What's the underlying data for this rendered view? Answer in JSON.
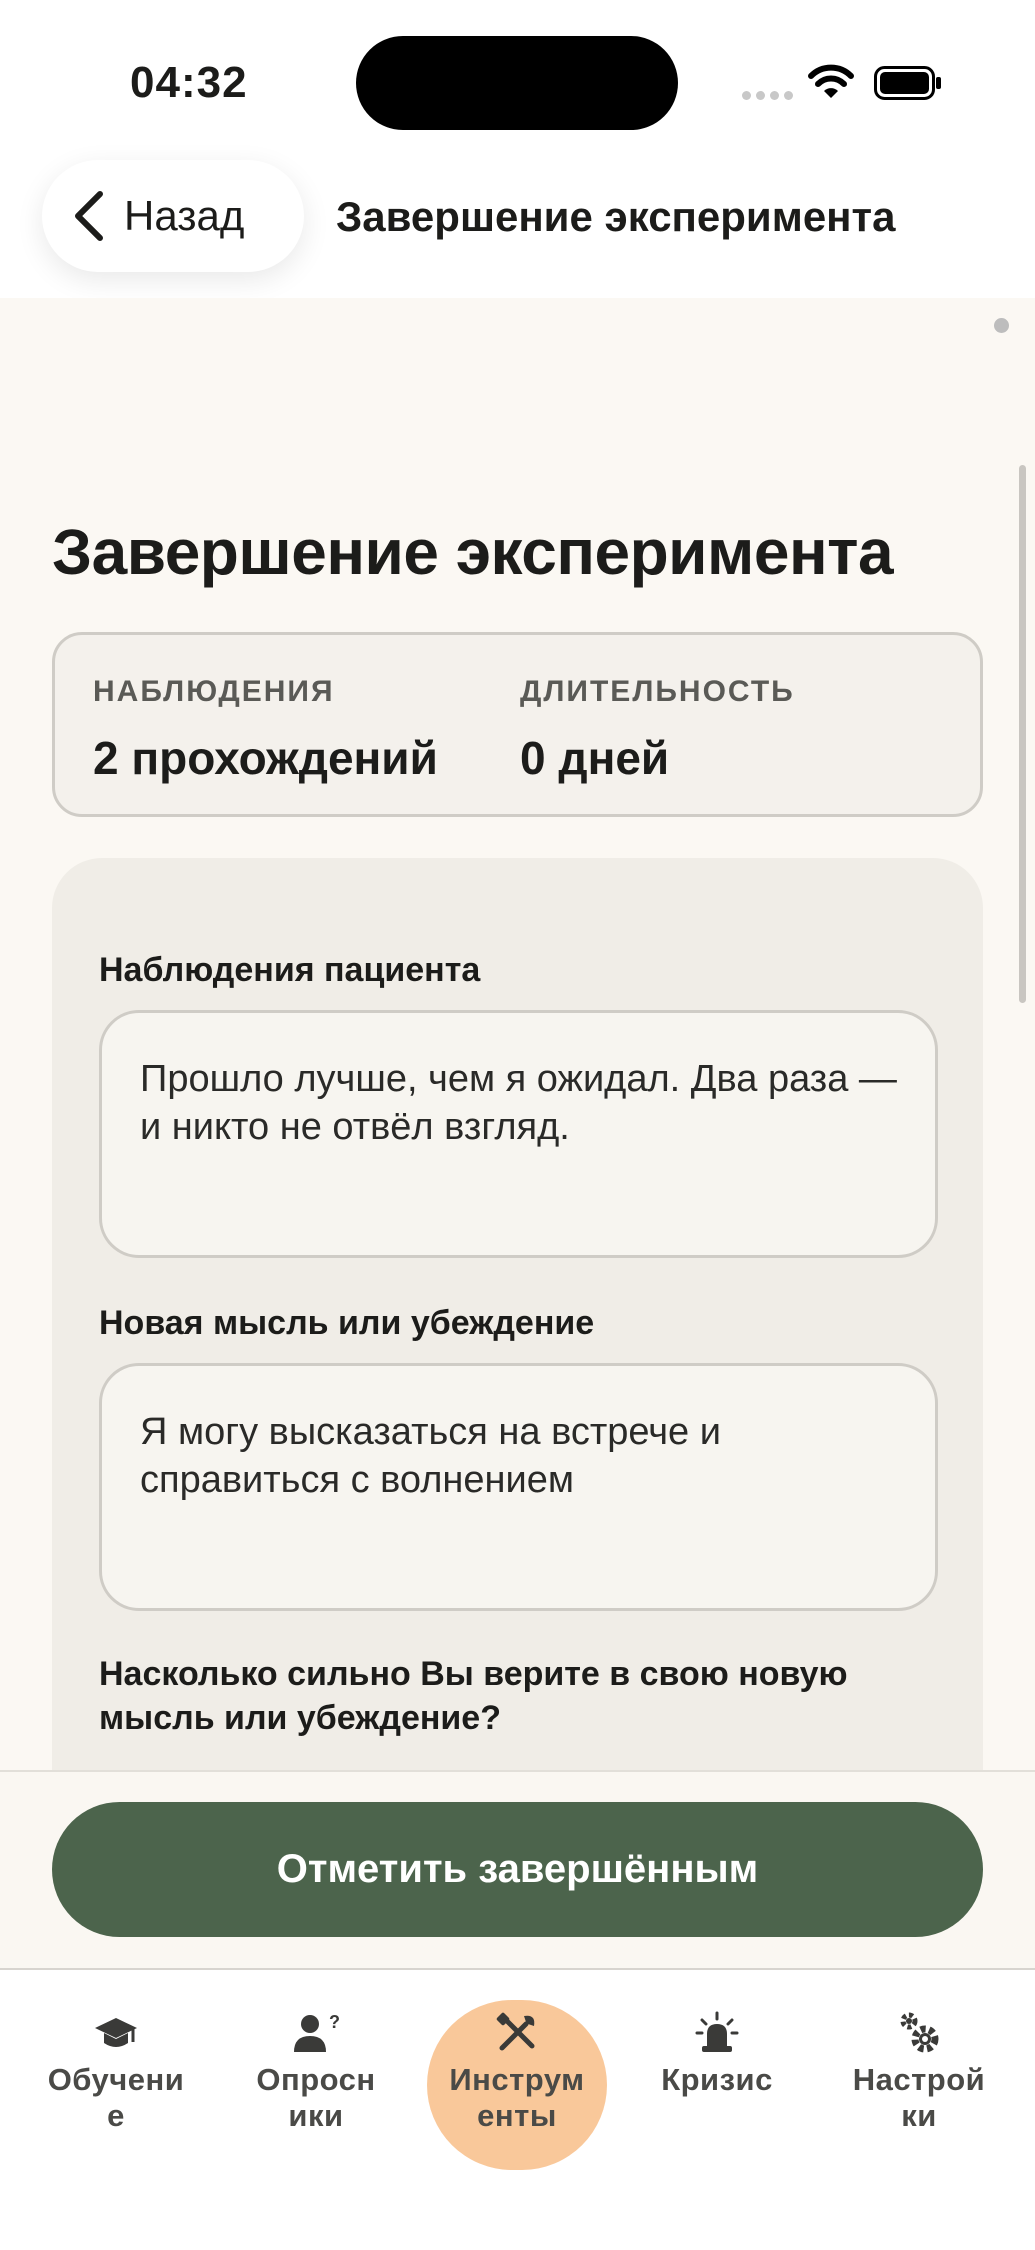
{
  "status": {
    "time": "04:32"
  },
  "nav": {
    "back_label": "Назад",
    "title": "Завершение эксперимента"
  },
  "page": {
    "title": "Завершение эксперимента"
  },
  "stats": {
    "observations_label": "НАБЛЮДЕНИЯ",
    "observations_value": "2 прохождений",
    "duration_label": "ДЛИТЕЛЬНОСТЬ",
    "duration_value": "0 дней"
  },
  "form": {
    "patient_observations_label": "Наблюдения пациента",
    "patient_observations_value": "Прошло лучше, чем я ожидал. Два раза — и никто не отвёл взгляд.",
    "new_thought_label": "Новая мысль или убеждение",
    "new_thought_value": "Я могу высказаться на встрече и справиться с волнением",
    "belief_question": "Насколько сильно Вы верите в свою новую мысль или убеждение?"
  },
  "actions": {
    "complete_label": "Отметить завершённым"
  },
  "tabs": [
    {
      "label": "Обучени\nе",
      "icon": "graduation-cap-icon"
    },
    {
      "label": "Опросн\nики",
      "icon": "user-question-icon"
    },
    {
      "label": "Инструм\nенты",
      "icon": "tools-icon",
      "active": true
    },
    {
      "label": "Кризис",
      "icon": "siren-icon"
    },
    {
      "label": "Настрой\nки",
      "icon": "gears-icon"
    }
  ],
  "colors": {
    "accent": "#4C644C",
    "active_tab": "#F9C89A",
    "background": "#FBF8F3"
  }
}
